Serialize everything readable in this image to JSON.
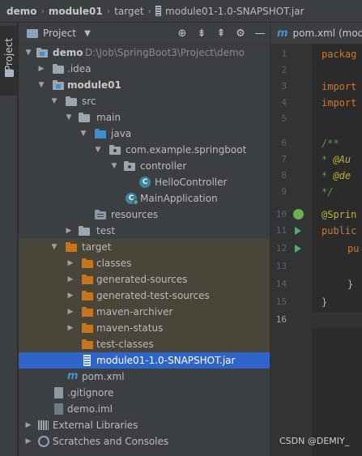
{
  "breadcrumb": {
    "items": [
      "demo",
      "module01",
      "target",
      "module01-1.0-SNAPSHOT.jar"
    ]
  },
  "toolstrip": {
    "tab_label": "Project"
  },
  "panel": {
    "title": "Project",
    "dropdown_icon": "chevron-down-icon",
    "buttons": [
      "locate-icon",
      "expand-all-icon",
      "collapse-all-icon",
      "gear-icon",
      "minimize-icon"
    ]
  },
  "tree": {
    "demo": {
      "label": "demo",
      "path": "D:\\Job\\SpringBoot3\\Project\\demo"
    },
    "idea": ".idea",
    "module01": "module01",
    "src": "src",
    "main": "main",
    "java": "java",
    "package": "com.example.springboot",
    "controller": "controller",
    "hello_controller": "HelloController",
    "main_application": "MainApplication",
    "resources": "resources",
    "test": "test",
    "target": "target",
    "classes": "classes",
    "generated_sources": "generated-sources",
    "generated_test_sources": "generated-test-sources",
    "maven_archiver": "maven-archiver",
    "maven_status": "maven-status",
    "test_classes": "test-classes",
    "jar": "module01-1.0-SNAPSHOT.jar",
    "pom": "pom.xml",
    "gitignore": ".gitignore",
    "demo_iml": "demo.iml",
    "external_libraries": "External Libraries",
    "scratches": "Scratches and Consoles"
  },
  "editor": {
    "tab_label": "pom.xml (mod",
    "line_numbers": [
      "1",
      "2",
      "3",
      "4",
      "5",
      "6",
      "7",
      "8",
      "9",
      "10",
      "11",
      "12",
      "13",
      "14",
      "15",
      "16"
    ],
    "lines": {
      "l1": "packag",
      "l3": "import",
      "l4": "import",
      "l6": "/**",
      "l7_star": " * ",
      "l7_tag": "@Au",
      "l8_star": " * ",
      "l8_tag": "@de",
      "l9": " */",
      "l10": "@Sprin",
      "l11": "public",
      "l12": "pu",
      "l14": "}",
      "l15": "}"
    }
  },
  "watermark": "CSDN @DEMIY_",
  "colors": {
    "selection": "#2f65ca",
    "excluded": "#4a4539",
    "folder_orange": "#c8741a",
    "folder_blue": "#3d8fd1",
    "folder_gray": "#9aa7b0",
    "folder_resources": "#8a9aa8"
  }
}
